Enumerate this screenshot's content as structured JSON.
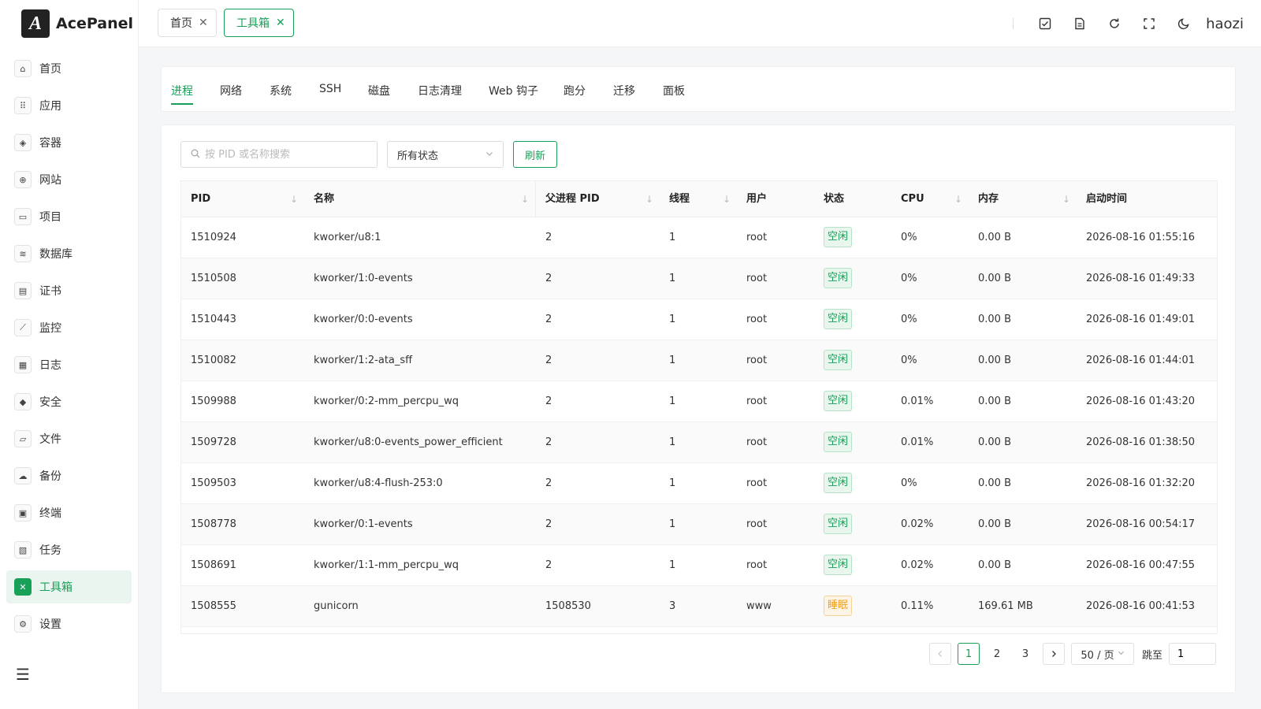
{
  "app": {
    "logo_letter": "A",
    "name": "AcePanel"
  },
  "sidebar": {
    "items": [
      {
        "label": "首页",
        "icon": "⌂",
        "icon_name": "home-icon"
      },
      {
        "label": "应用",
        "icon": "⠿",
        "icon_name": "apps-icon"
      },
      {
        "label": "容器",
        "icon": "◈",
        "icon_name": "container-icon"
      },
      {
        "label": "网站",
        "icon": "⊕",
        "icon_name": "globe-icon"
      },
      {
        "label": "项目",
        "icon": "▭",
        "icon_name": "project-icon"
      },
      {
        "label": "数据库",
        "icon": "≋",
        "icon_name": "database-icon"
      },
      {
        "label": "证书",
        "icon": "▤",
        "icon_name": "certificate-icon"
      },
      {
        "label": "监控",
        "icon": "⟋",
        "icon_name": "chart-icon"
      },
      {
        "label": "日志",
        "icon": "▦",
        "icon_name": "log-icon"
      },
      {
        "label": "安全",
        "icon": "◆",
        "icon_name": "shield-icon"
      },
      {
        "label": "文件",
        "icon": "▱",
        "icon_name": "folder-icon"
      },
      {
        "label": "备份",
        "icon": "☁",
        "icon_name": "backup-icon"
      },
      {
        "label": "终端",
        "icon": "▣",
        "icon_name": "terminal-icon"
      },
      {
        "label": "任务",
        "icon": "▧",
        "icon_name": "task-icon"
      },
      {
        "label": "工具箱",
        "icon": "✕",
        "icon_name": "toolbox-icon",
        "active": true
      },
      {
        "label": "设置",
        "icon": "⚙",
        "icon_name": "gear-icon"
      }
    ]
  },
  "header": {
    "tags": [
      {
        "label": "首页",
        "active": false
      },
      {
        "label": "工具箱",
        "active": true
      }
    ],
    "close_glyph": "✕",
    "user": "haozi"
  },
  "tabs": [
    "进程",
    "网络",
    "系统",
    "SSH",
    "磁盘",
    "日志清理",
    "Web 钩子",
    "跑分",
    "迁移",
    "面板"
  ],
  "filters": {
    "search_placeholder": "按 PID 或名称搜索",
    "status_select": "所有状态",
    "refresh_label": "刷新"
  },
  "table": {
    "columns": [
      "PID",
      "名称",
      "父进程 PID",
      "线程",
      "用户",
      "状态",
      "CPU",
      "内存",
      "启动时间"
    ],
    "rows": [
      {
        "pid": "1510924",
        "name": "kworker/u8:1",
        "ppid": "2",
        "threads": "1",
        "user": "root",
        "status": "空闲",
        "status_type": "idle",
        "cpu": "0%",
        "mem": "0.00 B",
        "start": "2026-08-16 01:55:16"
      },
      {
        "pid": "1510508",
        "name": "kworker/1:0-events",
        "ppid": "2",
        "threads": "1",
        "user": "root",
        "status": "空闲",
        "status_type": "idle",
        "cpu": "0%",
        "mem": "0.00 B",
        "start": "2026-08-16 01:49:33"
      },
      {
        "pid": "1510443",
        "name": "kworker/0:0-events",
        "ppid": "2",
        "threads": "1",
        "user": "root",
        "status": "空闲",
        "status_type": "idle",
        "cpu": "0%",
        "mem": "0.00 B",
        "start": "2026-08-16 01:49:01"
      },
      {
        "pid": "1510082",
        "name": "kworker/1:2-ata_sff",
        "ppid": "2",
        "threads": "1",
        "user": "root",
        "status": "空闲",
        "status_type": "idle",
        "cpu": "0%",
        "mem": "0.00 B",
        "start": "2026-08-16 01:44:01"
      },
      {
        "pid": "1509988",
        "name": "kworker/0:2-mm_percpu_wq",
        "ppid": "2",
        "threads": "1",
        "user": "root",
        "status": "空闲",
        "status_type": "idle",
        "cpu": "0.01%",
        "mem": "0.00 B",
        "start": "2026-08-16 01:43:20"
      },
      {
        "pid": "1509728",
        "name": "kworker/u8:0-events_power_efficient",
        "ppid": "2",
        "threads": "1",
        "user": "root",
        "status": "空闲",
        "status_type": "idle",
        "cpu": "0.01%",
        "mem": "0.00 B",
        "start": "2026-08-16 01:38:50"
      },
      {
        "pid": "1509503",
        "name": "kworker/u8:4-flush-253:0",
        "ppid": "2",
        "threads": "1",
        "user": "root",
        "status": "空闲",
        "status_type": "idle",
        "cpu": "0%",
        "mem": "0.00 B",
        "start": "2026-08-16 01:32:20"
      },
      {
        "pid": "1508778",
        "name": "kworker/0:1-events",
        "ppid": "2",
        "threads": "1",
        "user": "root",
        "status": "空闲",
        "status_type": "idle",
        "cpu": "0.02%",
        "mem": "0.00 B",
        "start": "2026-08-16 00:54:17"
      },
      {
        "pid": "1508691",
        "name": "kworker/1:1-mm_percpu_wq",
        "ppid": "2",
        "threads": "1",
        "user": "root",
        "status": "空闲",
        "status_type": "idle",
        "cpu": "0.02%",
        "mem": "0.00 B",
        "start": "2026-08-16 00:47:55"
      },
      {
        "pid": "1508555",
        "name": "gunicorn",
        "ppid": "1508530",
        "threads": "3",
        "user": "www",
        "status": "睡眠",
        "status_type": "sleep",
        "cpu": "0.11%",
        "mem": "169.61 MB",
        "start": "2026-08-16 00:41:53"
      }
    ]
  },
  "pagination": {
    "pages": [
      "1",
      "2",
      "3"
    ],
    "current": "1",
    "page_size": "50 / 页",
    "jump_label": "跳至",
    "jump_value": "1"
  },
  "colors": {
    "accent": "#18a058",
    "idle_bg": "#e8f6ee",
    "idle_border": "#b6e3c8",
    "sleep_color": "#f0a020",
    "sleep_bg": "#fdf4e6",
    "sleep_border": "#f5d39b"
  }
}
